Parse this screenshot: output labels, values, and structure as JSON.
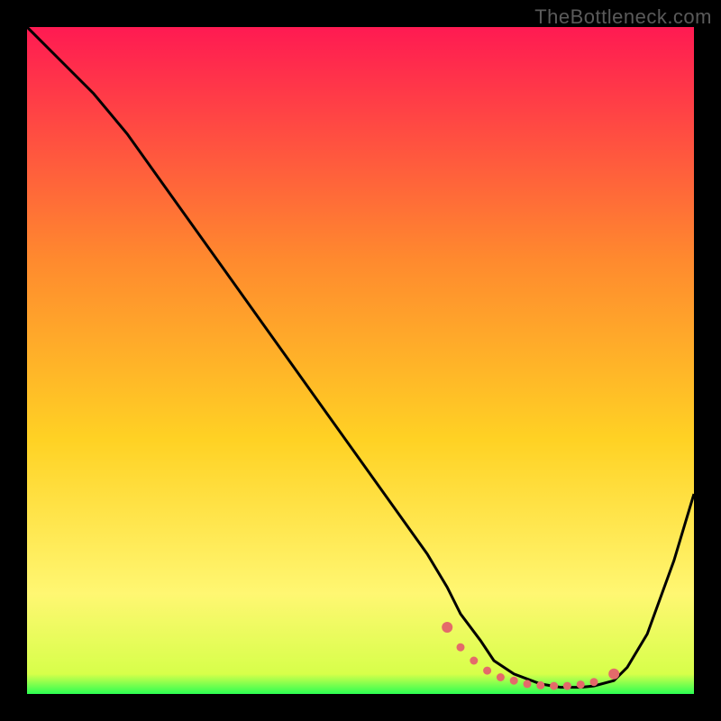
{
  "watermark": "TheBottleneck.com",
  "colors": {
    "bg_black": "#000000",
    "grad_top": "#ff1a52",
    "grad_mid1": "#ff6a2e",
    "grad_mid2": "#ffd224",
    "grad_mid3": "#fff772",
    "grad_bottom": "#2cff52",
    "curve": "#000000",
    "markers": "#e46a6a"
  },
  "chart_data": {
    "type": "line",
    "title": "",
    "xlabel": "",
    "ylabel": "",
    "xlim": [
      0,
      100
    ],
    "ylim": [
      0,
      100
    ],
    "series": [
      {
        "name": "bottleneck-curve",
        "x": [
          0,
          5,
          10,
          15,
          20,
          25,
          30,
          35,
          40,
          45,
          50,
          55,
          60,
          63,
          65,
          68,
          70,
          73,
          77,
          80,
          83,
          85,
          88,
          90,
          93,
          97,
          100
        ],
        "values": [
          100,
          95,
          90,
          84,
          77,
          70,
          63,
          56,
          49,
          42,
          35,
          28,
          21,
          16,
          12,
          8,
          5,
          3,
          1.5,
          1,
          1,
          1.2,
          2,
          4,
          9,
          20,
          30
        ]
      }
    ],
    "markers": {
      "name": "optimal-zone-markers",
      "x": [
        63,
        65,
        67,
        69,
        71,
        73,
        75,
        77,
        79,
        81,
        83,
        85,
        88
      ],
      "values": [
        10,
        7,
        5,
        3.5,
        2.5,
        2,
        1.5,
        1.3,
        1.2,
        1.2,
        1.4,
        1.8,
        3
      ]
    }
  }
}
